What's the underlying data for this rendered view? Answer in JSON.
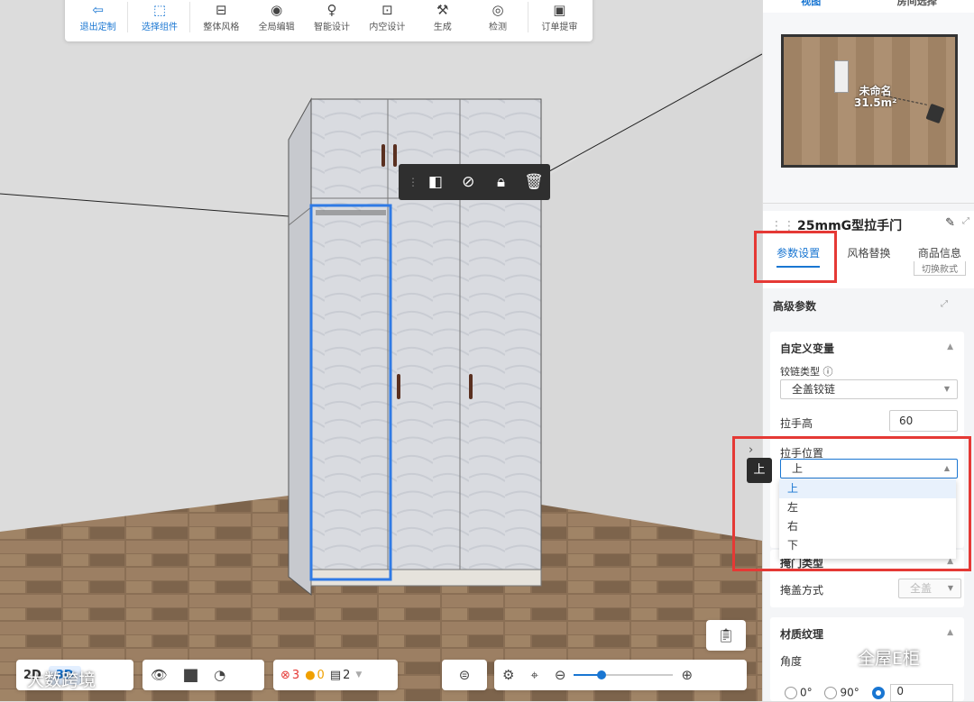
{
  "toolbar": {
    "items": [
      {
        "label": "退出定制",
        "icon": "exit-icon"
      },
      {
        "label": "选择组件",
        "icon": "select-icon"
      },
      {
        "label": "整体风格",
        "icon": "paint-roller-icon"
      },
      {
        "label": "全局编辑",
        "icon": "global-edit-icon"
      },
      {
        "label": "智能设计",
        "icon": "smart-design-icon"
      },
      {
        "label": "内空设计",
        "icon": "inner-space-icon"
      },
      {
        "label": "生成",
        "icon": "generate-icon"
      },
      {
        "label": "检测",
        "icon": "detect-icon"
      },
      {
        "label": "订单提审",
        "icon": "order-icon"
      }
    ]
  },
  "object_tools": [
    "door-icon",
    "hide-icon",
    "lock-icon",
    "delete-icon"
  ],
  "bottom": {
    "view2d": "2D",
    "view3d": "3D",
    "errors": "3",
    "warnings": "0",
    "layers": "2"
  },
  "watermarks": {
    "left": "大数跨境",
    "right": "全屋E柜"
  },
  "panel": {
    "view_tabs": [
      "视图",
      "房间选择"
    ],
    "room": {
      "name": "未命名",
      "area": "31.5m²"
    },
    "title": "25mmG型拉手门",
    "tabs": [
      "参数设置",
      "风格替换",
      "商品信息"
    ],
    "peek_button": "切换款式",
    "advanced": "高级参数",
    "custom_vars": {
      "title": "自定义变量",
      "hinge_label": "铰链类型",
      "hinge_value": "全盖铰链",
      "handle_height_label": "拉手高",
      "handle_height_value": "60",
      "handle_pos_label": "拉手位置",
      "handle_pos_value": "上",
      "options": [
        "上",
        "左",
        "右",
        "下"
      ]
    },
    "door_type": {
      "title": "掩门类型",
      "cover_label": "掩盖方式",
      "cover_value": "全盖"
    },
    "material": {
      "title": "材质纹理",
      "angle_label": "角度",
      "angles": [
        "0°",
        "90°"
      ],
      "angle_value": "0"
    }
  },
  "tooltip": "上",
  "colors": {
    "accent": "#1976d2",
    "highlight": "#e53935",
    "selection": "#2f7ae5"
  }
}
